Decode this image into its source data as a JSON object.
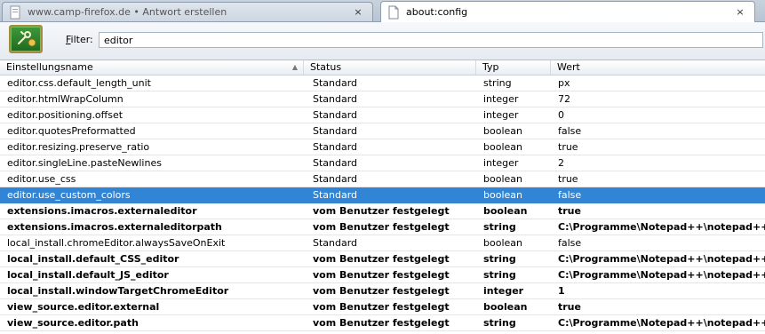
{
  "tabs": [
    {
      "title": "www.camp-firefox.de • Antwort erstellen",
      "close": "×"
    },
    {
      "title": "about:config",
      "close": "×"
    }
  ],
  "filter": {
    "label_accel": "F",
    "label_rest": "ilter:",
    "value": "editor"
  },
  "columns": {
    "name": "Einstellungsname",
    "status": "Status",
    "type": "Typ",
    "value": "Wert",
    "sort_indicator": "▲"
  },
  "rows": [
    {
      "name": "editor.css.default_length_unit",
      "status": "Standard",
      "type": "string",
      "value": "px"
    },
    {
      "name": "editor.htmlWrapColumn",
      "status": "Standard",
      "type": "integer",
      "value": "72"
    },
    {
      "name": "editor.positioning.offset",
      "status": "Standard",
      "type": "integer",
      "value": "0"
    },
    {
      "name": "editor.quotesPreformatted",
      "status": "Standard",
      "type": "boolean",
      "value": "false"
    },
    {
      "name": "editor.resizing.preserve_ratio",
      "status": "Standard",
      "type": "boolean",
      "value": "true"
    },
    {
      "name": "editor.singleLine.pasteNewlines",
      "status": "Standard",
      "type": "integer",
      "value": "2"
    },
    {
      "name": "editor.use_css",
      "status": "Standard",
      "type": "boolean",
      "value": "true"
    },
    {
      "name": "editor.use_custom_colors",
      "status": "Standard",
      "type": "boolean",
      "value": "false"
    },
    {
      "name": "extensions.imacros.externaleditor",
      "status": "vom Benutzer festgelegt",
      "type": "boolean",
      "value": "true"
    },
    {
      "name": "extensions.imacros.externaleditorpath",
      "status": "vom Benutzer festgelegt",
      "type": "string",
      "value": "C:\\Programme\\Notepad++\\notepad++.exe"
    },
    {
      "name": "local_install.chromeEditor.alwaysSaveOnExit",
      "status": "Standard",
      "type": "boolean",
      "value": "false"
    },
    {
      "name": "local_install.default_CSS_editor",
      "status": "vom Benutzer festgelegt",
      "type": "string",
      "value": "C:\\Programme\\Notepad++\\notepad++.exe"
    },
    {
      "name": "local_install.default_JS_editor",
      "status": "vom Benutzer festgelegt",
      "type": "string",
      "value": "C:\\Programme\\Notepad++\\notepad++.exe"
    },
    {
      "name": "local_install.windowTargetChromeEditor",
      "status": "vom Benutzer festgelegt",
      "type": "integer",
      "value": "1"
    },
    {
      "name": "view_source.editor.external",
      "status": "vom Benutzer festgelegt",
      "type": "boolean",
      "value": "true"
    },
    {
      "name": "view_source.editor.path",
      "status": "vom Benutzer festgelegt",
      "type": "string",
      "value": "C:\\Programme\\Notepad++\\notepad++.exe"
    }
  ],
  "selected_row": "editor.use_custom_colors",
  "icons": {
    "logo": "about-config-green-logo-icon",
    "tab1": "page-icon",
    "tab2": "blank-page-icon"
  },
  "colors": {
    "selection": "#3284d4",
    "tabstrip": "#c9d3de"
  }
}
